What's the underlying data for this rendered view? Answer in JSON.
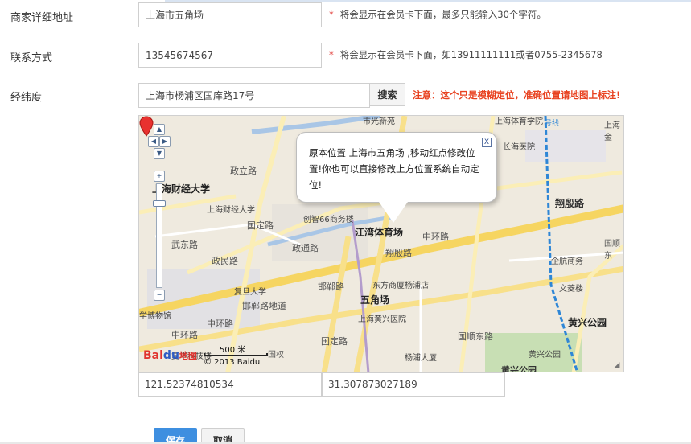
{
  "form": {
    "address": {
      "label": "商家详细地址",
      "value": "上海市五角场",
      "hint": "将会显示在会员卡下面，最多只能输入30个字符。"
    },
    "contact": {
      "label": "联系方式",
      "value": "13545674567",
      "hint": "将会显示在会员卡下面，如13911111111或者0755-2345678"
    },
    "coords": {
      "label": "经纬度",
      "search_value": "上海市杨浦区国庠路17号",
      "search_button": "搜索",
      "warning": "注意：这个只是模糊定位，准确位置请地图上标注!",
      "longitude": "121.52374810534",
      "latitude": "31.307873027189"
    },
    "required_mark": "*",
    "buttons": {
      "save": "保存",
      "cancel": "取消"
    }
  },
  "map": {
    "popup_text": "原本位置 上海市五角场 ,移动红点修改位置!你也可以直接修改上方位置系统自动定位!",
    "popup_close": "X",
    "scale": "500 米",
    "logo_part1": "Bai",
    "logo_part2": "du",
    "logo_part3": "地图",
    "copyright": "© 2013 Baidu",
    "labels": [
      {
        "id": "l1",
        "text": "市光新苑"
      },
      {
        "id": "l2",
        "text": "上海体育学院"
      },
      {
        "id": "l3",
        "text": "上海金"
      },
      {
        "id": "l4",
        "text": "政立路"
      },
      {
        "id": "l5",
        "text": "长海医院"
      },
      {
        "id": "l6",
        "text": "上海财经大学"
      },
      {
        "id": "l7",
        "text": "上海财经大学"
      },
      {
        "id": "l8",
        "text": "翔殷路"
      },
      {
        "id": "l9",
        "text": "创智66商务楼"
      },
      {
        "id": "l10",
        "text": "江湾体育场"
      },
      {
        "id": "l11",
        "text": "武东路"
      },
      {
        "id": "l12",
        "text": "国定路"
      },
      {
        "id": "l13",
        "text": "政通路"
      },
      {
        "id": "l14",
        "text": "中环路"
      },
      {
        "id": "l15",
        "text": "政民路"
      },
      {
        "id": "l16",
        "text": "翔殷路"
      },
      {
        "id": "l17",
        "text": "企航商务"
      },
      {
        "id": "l18",
        "text": "国顺东"
      },
      {
        "id": "l19",
        "text": "复旦大学"
      },
      {
        "id": "l20",
        "text": "邯郸路"
      },
      {
        "id": "l21",
        "text": "东方商厦杨浦店"
      },
      {
        "id": "l22",
        "text": "文菱楼"
      },
      {
        "id": "l23",
        "text": "五角场"
      },
      {
        "id": "l24",
        "text": "学博物馆"
      },
      {
        "id": "l25",
        "text": "邯郸路地道"
      },
      {
        "id": "l26",
        "text": "上海黄兴医院"
      },
      {
        "id": "l27",
        "text": "黄兴公园"
      },
      {
        "id": "l28",
        "text": "中环路"
      },
      {
        "id": "l29",
        "text": "中环路"
      },
      {
        "id": "l30",
        "text": "国定路"
      },
      {
        "id": "l31",
        "text": "国顺东路"
      },
      {
        "id": "l32",
        "text": "黄兴公园"
      },
      {
        "id": "l33",
        "text": "复华科技楼"
      },
      {
        "id": "l34",
        "text": "杨浦大厦"
      },
      {
        "id": "l35",
        "text": "国权"
      },
      {
        "id": "l36",
        "text": "黄兴公园"
      },
      {
        "id": "l37",
        "text": "号线"
      }
    ]
  }
}
